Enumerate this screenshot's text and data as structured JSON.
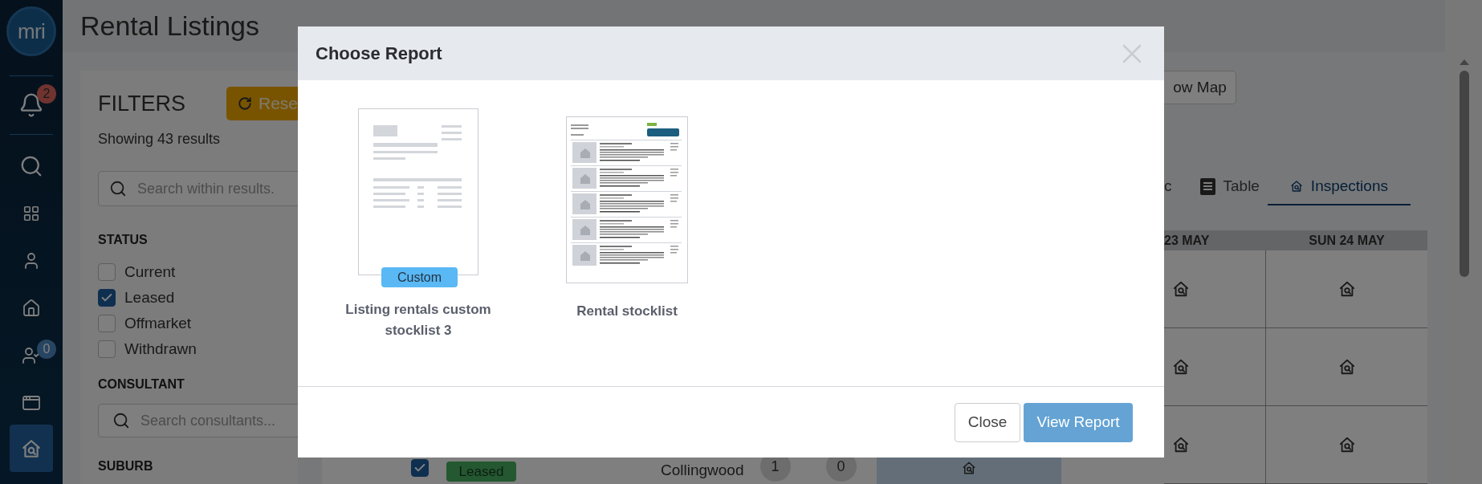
{
  "page": {
    "title": "Rental Listings"
  },
  "sidebar": {
    "logo": "mri",
    "items": [
      {
        "kind": "notifications",
        "badge": "2",
        "selected": false
      },
      {
        "kind": "search",
        "selected": false
      },
      {
        "kind": "dashboard",
        "selected": false
      },
      {
        "kind": "contacts",
        "selected": false
      },
      {
        "kind": "properties",
        "selected": false
      },
      {
        "kind": "tasks",
        "badge": "0",
        "selected": false
      },
      {
        "kind": "presentations",
        "selected": false
      },
      {
        "kind": "rentals",
        "selected": true
      }
    ]
  },
  "filters": {
    "heading": "FILTERS",
    "reset_button": "Rese",
    "result_count": "Showing 43 results",
    "search": {
      "placeholder": "Search within results."
    },
    "sections": [
      {
        "heading": "STATUS",
        "options": [
          {
            "label": "Current",
            "checked": false
          },
          {
            "label": "Leased",
            "checked": true
          },
          {
            "label": "Offmarket",
            "checked": false
          },
          {
            "label": "Withdrawn",
            "checked": false
          }
        ]
      },
      {
        "heading": "CONSULTANT",
        "search": {
          "placeholder": "Search consultants..."
        }
      },
      {
        "heading": "SUBURB"
      }
    ]
  },
  "listing_row": {
    "checked": true,
    "status": "Leased",
    "suburb": "Collingwood",
    "count_1": "1",
    "count_2": "0"
  },
  "view": {
    "map_button": "ow Map",
    "tabs": [
      {
        "label": "c",
        "kind": "text",
        "selected": false
      },
      {
        "label": "Table",
        "kind": "table",
        "selected": false
      },
      {
        "label": "Inspections",
        "kind": "inspections",
        "selected": true
      }
    ],
    "calendar": {
      "columns": [
        "23 MAY",
        "SUN 24 MAY"
      ],
      "rows": [
        {
          "cells": [
            true,
            true
          ]
        },
        {
          "cells": [
            true,
            true
          ]
        },
        {
          "cells": [
            true,
            true
          ]
        }
      ]
    }
  },
  "dialog": {
    "title": "Choose Report",
    "reports": [
      {
        "name": "Listing rentals custom stocklist 3",
        "badge": "Custom",
        "kind": "custom"
      },
      {
        "name": "Rental stocklist",
        "kind": "stocklist"
      }
    ],
    "buttons": [
      {
        "label": "Close",
        "kind": "secondary"
      },
      {
        "label": "View Report",
        "kind": "primary"
      }
    ]
  }
}
